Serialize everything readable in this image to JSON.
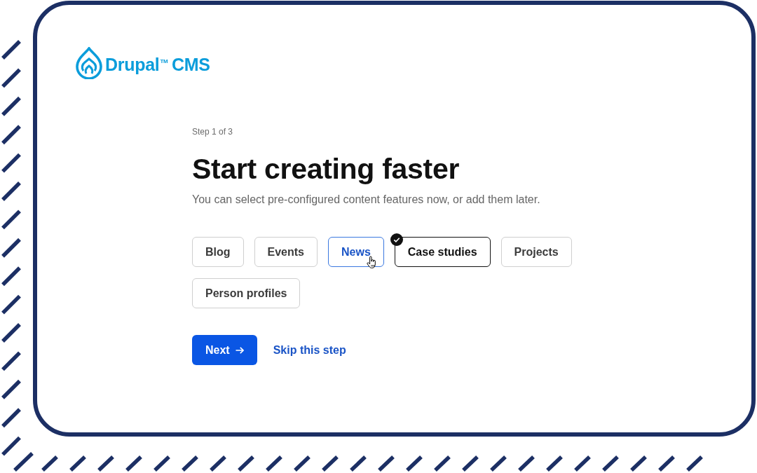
{
  "logo": {
    "text": "Drupal$^{TM}$ CMS"
  },
  "step": "Step 1 of 3",
  "title": "Start creating faster",
  "subtitle": "You can select pre-configured content features now, or add them later.",
  "features": [
    {
      "label": "Blog",
      "selected": false,
      "hovered": false
    },
    {
      "label": "Events",
      "selected": false,
      "hovered": false
    },
    {
      "label": "News",
      "selected": false,
      "hovered": true
    },
    {
      "label": "Case studies",
      "selected": true,
      "hovered": false
    },
    {
      "label": "Projects",
      "selected": false,
      "hovered": false
    },
    {
      "label": "Person profiles",
      "selected": false,
      "hovered": false
    }
  ],
  "actions": {
    "next": {
      "label": "Next"
    },
    "skip": {
      "label": "Skip this step"
    }
  }
}
